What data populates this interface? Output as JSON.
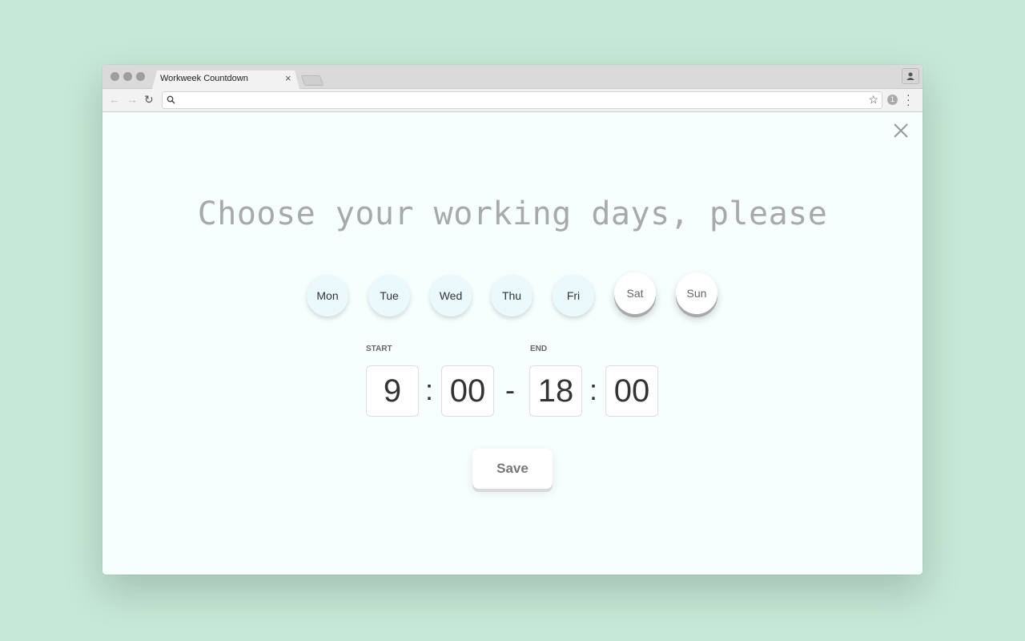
{
  "browser": {
    "tab_title": "Workweek Countdown",
    "tab_close": "×",
    "address": "",
    "extension_badge": "1"
  },
  "page": {
    "heading": "Choose your working days, please",
    "days": [
      {
        "label": "Mon",
        "selected": true
      },
      {
        "label": "Tue",
        "selected": true
      },
      {
        "label": "Wed",
        "selected": true
      },
      {
        "label": "Thu",
        "selected": true
      },
      {
        "label": "Fri",
        "selected": true
      },
      {
        "label": "Sat",
        "selected": false
      },
      {
        "label": "Sun",
        "selected": false
      }
    ],
    "start_label": "START",
    "end_label": "END",
    "start_hour": "9",
    "start_minute": "00",
    "end_hour": "18",
    "end_minute": "00",
    "colon": ":",
    "dash": "-",
    "save_label": "Save"
  }
}
